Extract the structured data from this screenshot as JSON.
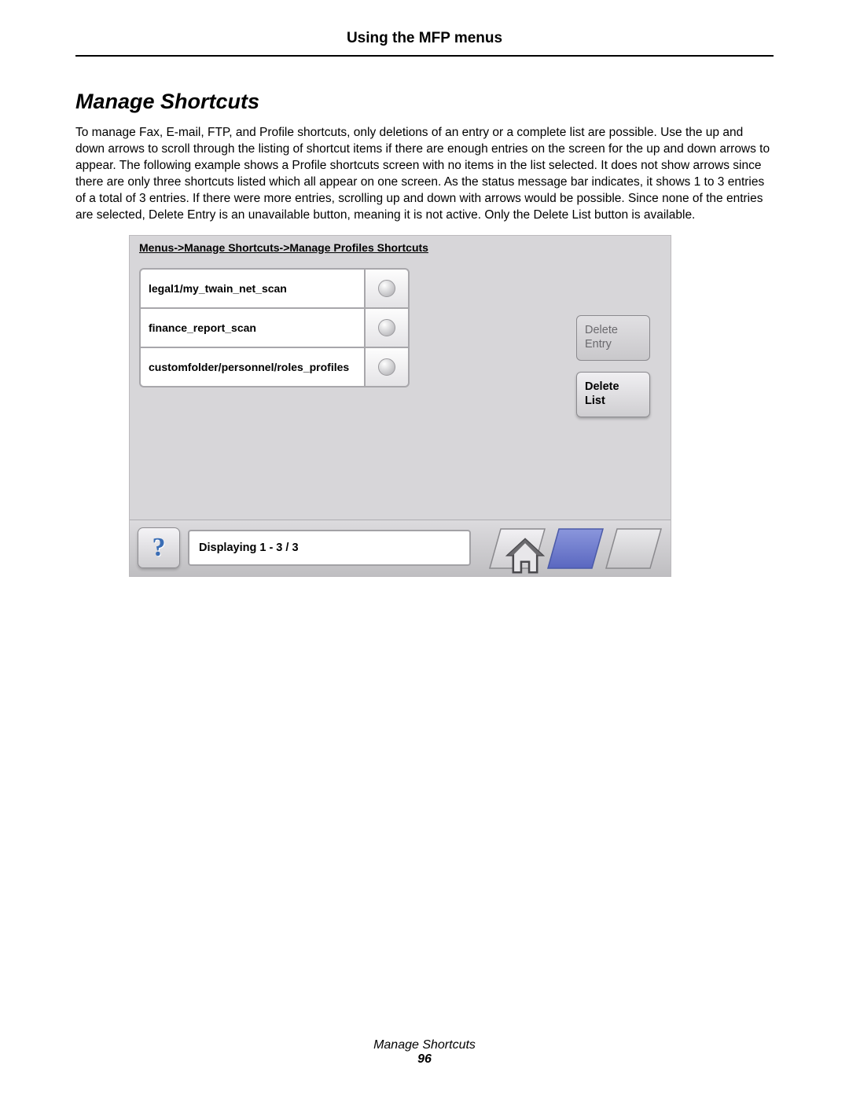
{
  "header": {
    "title": "Using the MFP menus"
  },
  "section": {
    "title": "Manage Shortcuts",
    "body": "To manage Fax, E-mail, FTP, and Profile shortcuts, only deletions of an entry or a complete list are possible. Use the up and down arrows to scroll through the listing of shortcut items if there are enough entries on the screen for the up and down arrows to appear. The following example shows a Profile shortcuts screen with no items in the list selected. It does not show arrows since there are only three shortcuts listed which all appear on one screen. As the status message bar indicates, it shows 1 to 3 entries of a total of 3 entries. If there were more entries, scrolling up and down with arrows would be possible. Since none of the entries are selected, Delete Entry is an unavailable button, meaning it is not active. Only the Delete List button is available."
  },
  "screen": {
    "breadcrumb": "Menus->Manage Shortcuts->Manage Profiles Shortcuts",
    "items": [
      {
        "label": "legal1/my_twain_net_scan"
      },
      {
        "label": "finance_report_scan"
      },
      {
        "label": "customfolder/personnel/roles_profiles"
      }
    ],
    "buttons": {
      "delete_entry": "Delete Entry",
      "delete_list": "Delete List"
    },
    "status": "Displaying 1 - 3 / 3"
  },
  "footer": {
    "title": "Manage Shortcuts",
    "page": "96"
  }
}
